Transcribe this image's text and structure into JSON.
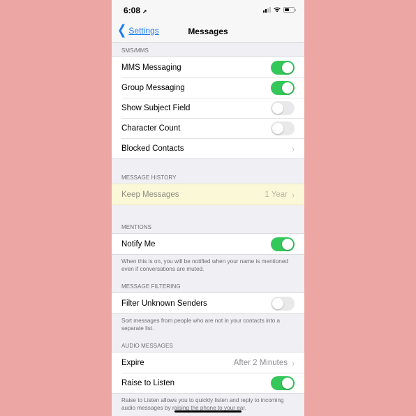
{
  "status_bar": {
    "time": "6:08",
    "location_icon": "location-arrow-icon",
    "signal_icon": "cellular-signal-icon",
    "wifi_icon": "wifi-icon",
    "battery_icon": "battery-icon"
  },
  "nav": {
    "back_label": "Settings",
    "title": "Messages"
  },
  "sections": {
    "sms_mms": {
      "header": "SMS/MMS",
      "rows": [
        {
          "label": "MMS Messaging",
          "toggle": true
        },
        {
          "label": "Group Messaging",
          "toggle": true
        },
        {
          "label": "Show Subject Field",
          "toggle": false
        },
        {
          "label": "Character Count",
          "toggle": false
        },
        {
          "label": "Blocked Contacts"
        }
      ]
    },
    "message_history": {
      "header": "MESSAGE HISTORY",
      "rows": [
        {
          "label": "Keep Messages",
          "value": "1 Year"
        }
      ]
    },
    "mentions": {
      "header": "MENTIONS",
      "rows": [
        {
          "label": "Notify Me",
          "toggle": true
        }
      ],
      "footer": "When this is on, you will be notified when your name is mentioned even if conversations are muted."
    },
    "message_filtering": {
      "header": "MESSAGE FILTERING",
      "rows": [
        {
          "label": "Filter Unknown Senders",
          "toggle": false
        }
      ],
      "footer": "Sort messages from people who are not in your contacts into a separate list."
    },
    "audio_messages": {
      "header": "AUDIO MESSAGES",
      "rows": [
        {
          "label": "Expire",
          "value": "After 2 Minutes"
        },
        {
          "label": "Raise to Listen",
          "toggle": true
        }
      ],
      "footer": "Raise to Listen allows you to quickly listen and reply to incoming audio messages by raising the phone to your ear."
    }
  },
  "colors": {
    "accent": "#1a7cf5",
    "toggle_on": "#34c759",
    "toggle_off": "#e9e9eb",
    "highlight": "#fbf8d8",
    "page_background": "#eca6a3"
  }
}
